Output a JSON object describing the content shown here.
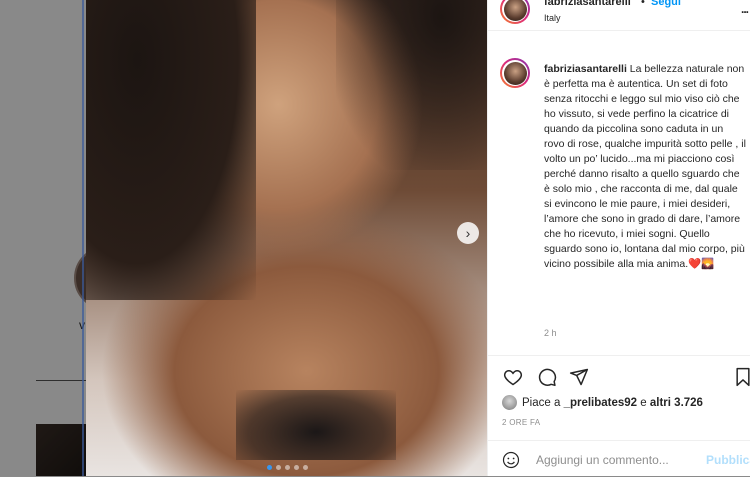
{
  "background": {
    "partial_name": "v"
  },
  "post": {
    "carousel": {
      "total": 5,
      "active_index": 0
    }
  },
  "header": {
    "username": "fabriziasantarelli",
    "separator": "•",
    "follow_label": "Segui",
    "location": "Italy",
    "more": "..."
  },
  "caption": {
    "username": "fabriziasantarelli",
    "text": "La bellezza naturale non è perfetta ma è autentica. Un set di foto senza ritocchi e leggo sul mio viso ciò che ho vissuto, si vede perfino la cicatrice di quando da piccolina sono caduta in un rovo di rose, qualche impurità sotto pelle , il volto un po’ lucido...ma mi piacciono così perché danno risalto a quello sguardo che è solo mio , che racconta di me, dal quale si evincono le mie paure, i miei desideri, l’amore che sono in grado di dare, l’amore che ho ricevuto, i miei sogni. Quello sguardo sono io, lontana dal mio corpo, più vicino possibile alla mia anima.❤️🌄",
    "time": "2 h"
  },
  "likes": {
    "prefix": "Piace a",
    "user": "_prelibates92",
    "middle": "e",
    "others": "altri 3.726"
  },
  "posted_ago": "2 ORE FA",
  "comment_box": {
    "placeholder": "Aggiungi un commento...",
    "publish_label": "Pubblica"
  },
  "icons": {
    "heart": "heart-icon",
    "comment": "comment-icon",
    "share": "share-icon",
    "save": "bookmark-icon",
    "emoji": "emoji-icon",
    "next": "chevron-right-icon"
  },
  "colors": {
    "accent": "#0095f6",
    "carousel_dot_active": "#3897f0",
    "muted": "#8e8e8e"
  }
}
